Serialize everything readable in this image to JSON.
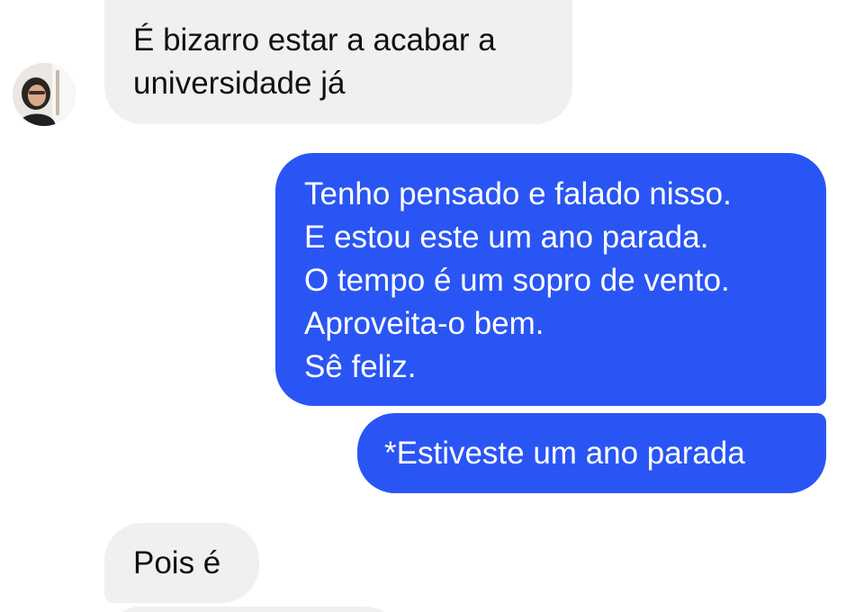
{
  "conversation": {
    "messages": [
      {
        "direction": "incoming",
        "text": "É bizarro estar a acabar a\nuniversidade já"
      },
      {
        "direction": "outgoing",
        "text": "Tenho pensado e falado nisso.\nE estou este um ano parada.\nO tempo é um sopro de vento.\nAproveita-o bem.\nSê feliz."
      },
      {
        "direction": "outgoing",
        "text": "*Estiveste um ano parada"
      },
      {
        "direction": "incoming",
        "text": "Pois é"
      }
    ]
  },
  "colors": {
    "incoming_bubble": "#f0f0f0",
    "outgoing_bubble": "#2a55f5",
    "incoming_text": "#111111",
    "outgoing_text": "#ffffff"
  },
  "avatar": {
    "icon": "contact-avatar-photo"
  }
}
